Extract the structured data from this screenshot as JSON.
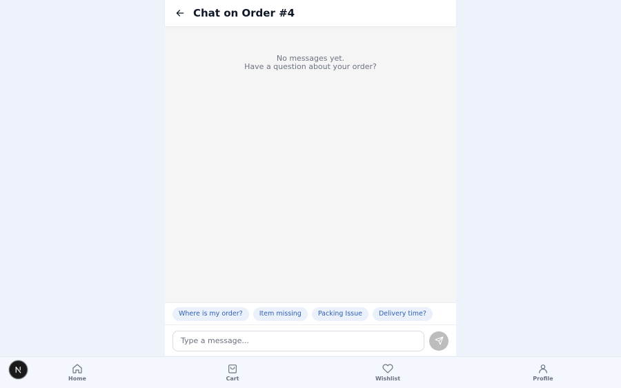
{
  "header": {
    "title": "Chat on Order #4",
    "back_icon": "arrow-left-icon"
  },
  "messages": {
    "empty_line1": "No messages yet.",
    "empty_line2": "Have a question about your order?"
  },
  "quick_replies": [
    "Where is my order?",
    "Item missing",
    "Packing Issue",
    "Delivery time?"
  ],
  "composer": {
    "placeholder": "Type a message...",
    "value": "",
    "send_icon": "send-icon"
  },
  "bottom_nav": {
    "items": [
      {
        "label": "Home",
        "icon": "home-icon"
      },
      {
        "label": "Cart",
        "icon": "cart-icon"
      },
      {
        "label": "Wishlist",
        "icon": "heart-icon"
      },
      {
        "label": "Profile",
        "icon": "user-icon"
      }
    ]
  },
  "dev_badge": {
    "icon": "nextjs-logo-icon"
  },
  "colors": {
    "page_bg": "#eef2fb",
    "chip_bg": "#eaf1fb",
    "chip_text": "#2f5fb3",
    "send_button": "#bdbdbd"
  }
}
